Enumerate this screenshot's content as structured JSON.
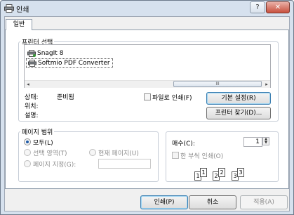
{
  "window": {
    "title": "인쇄",
    "help_glyph": "?",
    "close_glyph": "✕"
  },
  "tabs": [
    {
      "label": "일반"
    }
  ],
  "select_printer": {
    "title": "프린터 선택",
    "printers": [
      {
        "name": "SnagIt 8",
        "selected": false
      },
      {
        "name": "Softmio PDF Converter",
        "selected": true
      }
    ],
    "scroll_left": "◂",
    "scroll_right": "▸",
    "scroll_grip": "III",
    "status_label": "상태:",
    "status_value": "준비됨",
    "location_label": "위치:",
    "location_value": "",
    "comment_label": "설명:",
    "comment_value": "",
    "print_to_file_label": "파일로 인쇄(F)",
    "print_to_file_checked": false,
    "preferences_button": "기본 설정(R)",
    "find_printer_button": "프린터 찾기(D)..."
  },
  "page_range": {
    "title": "페이지 범위",
    "options": [
      {
        "label": "모두(L)",
        "checked": true,
        "enabled": true
      },
      {
        "label": "선택 영역(T)",
        "checked": false,
        "enabled": false
      },
      {
        "label": "현재 페이지(U)",
        "checked": false,
        "enabled": false
      },
      {
        "label": "페이지 지정(G):",
        "checked": false,
        "enabled": false
      }
    ],
    "pages_value": ""
  },
  "copies": {
    "label": "매수(C):",
    "value": "1",
    "spin_up": "▲",
    "spin_down": "▼",
    "collate_label": "한 부씩 인쇄(O)",
    "collate_checked": false,
    "collate_pages": [
      "1",
      "1",
      "2",
      "2",
      "3",
      "3"
    ]
  },
  "footer": {
    "print_button": "인쇄(P)",
    "cancel_button": "취소",
    "apply_button": "적용(A)"
  },
  "colors": {
    "titlebar": "#d6e1ee",
    "default_button_border": "#3c7fb1",
    "radio_dot": "#1f5aa6"
  }
}
